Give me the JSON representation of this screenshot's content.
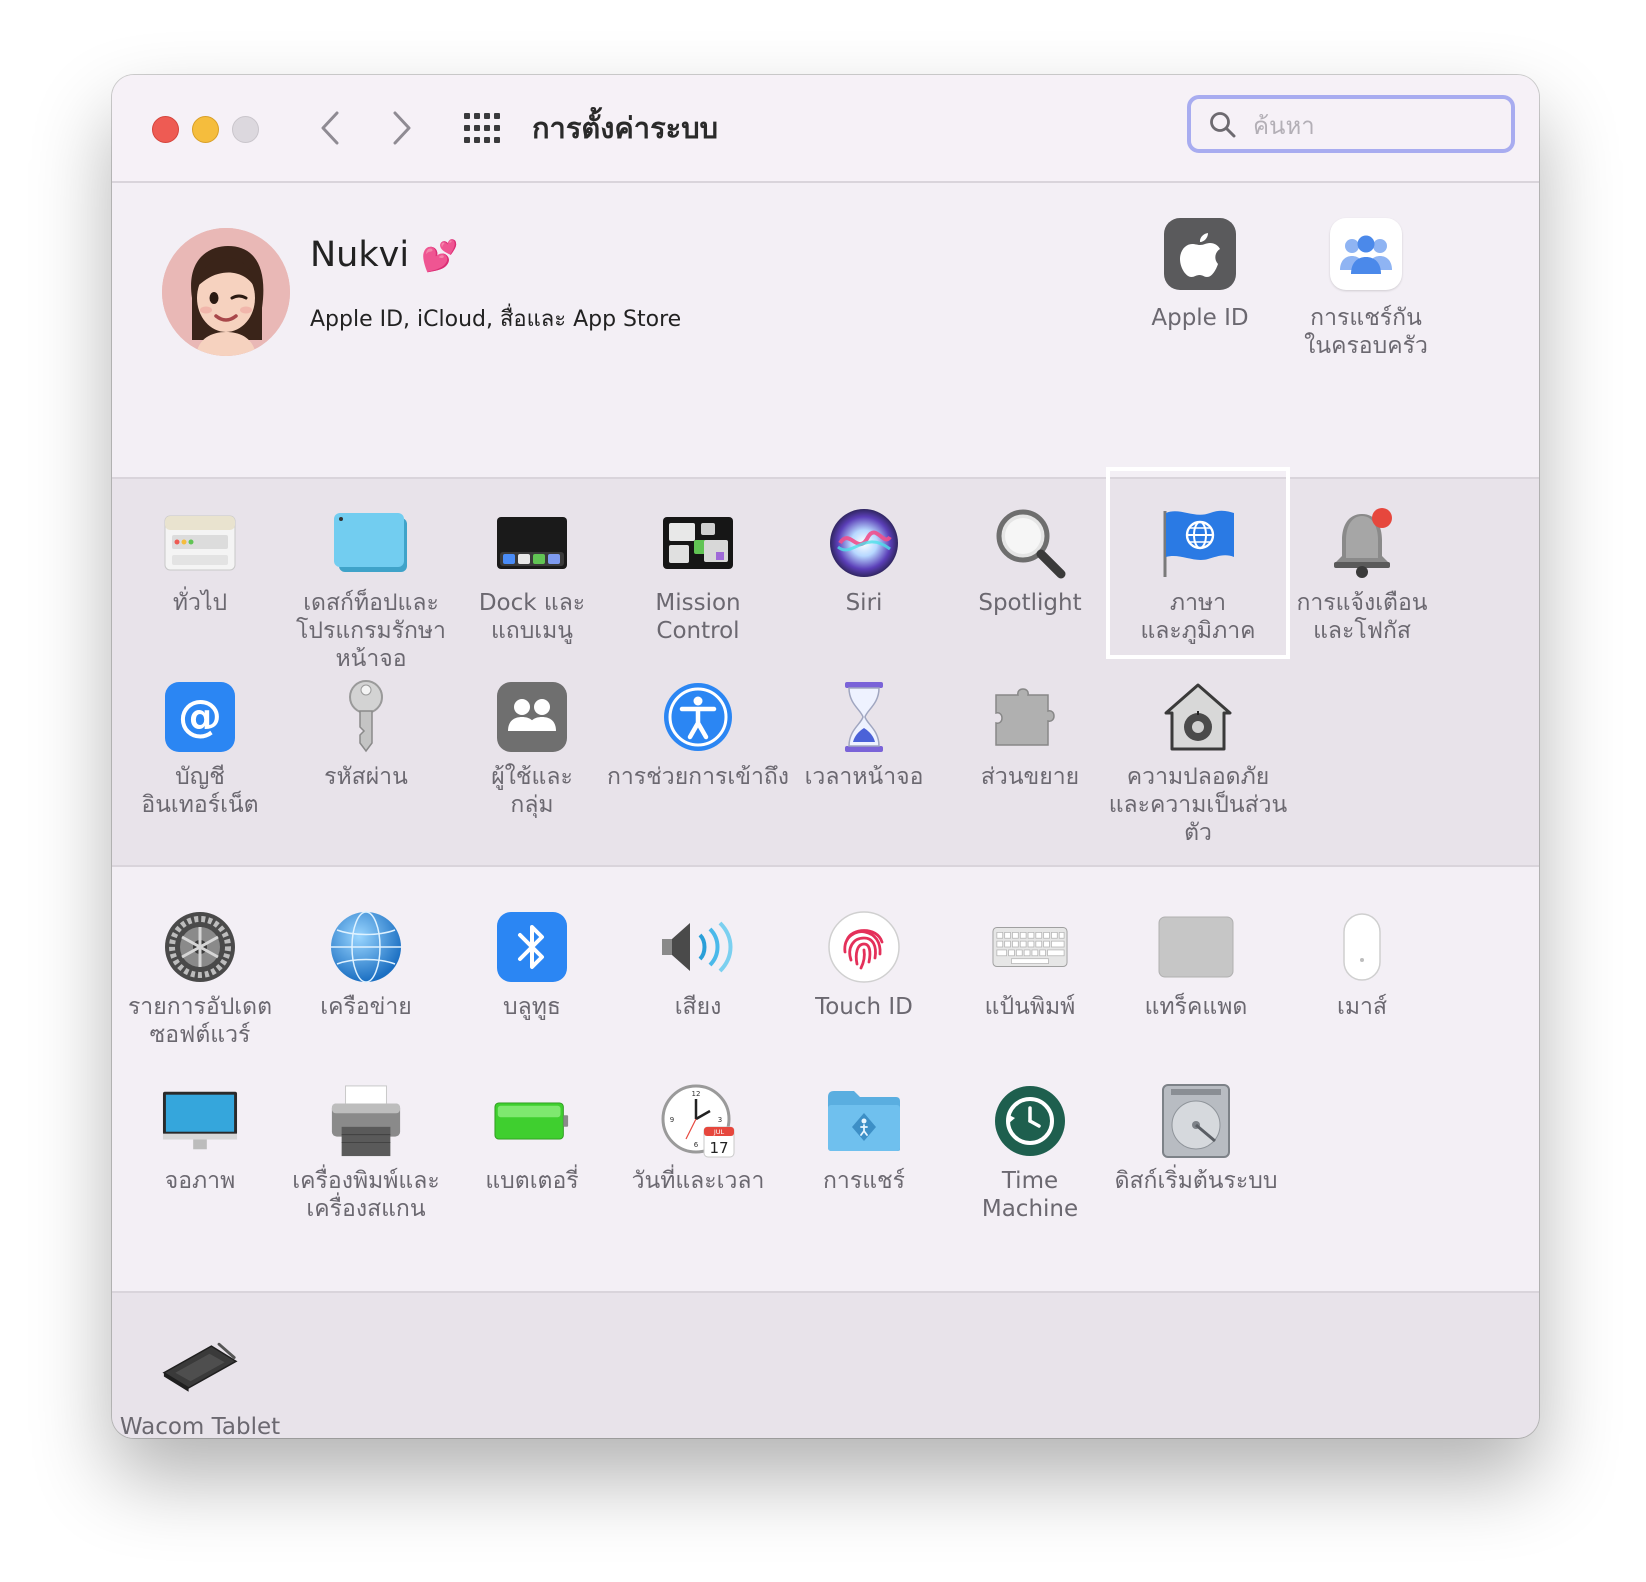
{
  "window": {
    "title": "การตั้งค่าระบบ",
    "search_placeholder": "ค้นหา"
  },
  "account": {
    "name": "Nukvi",
    "emoji": "💕",
    "subtitle": "Apple ID, iCloud, สื่อและ App Store",
    "apple_id_label": "Apple ID",
    "family_label_1": "การแชร์กัน",
    "family_label_2": "ในครอบครัว"
  },
  "section1": {
    "general": [
      "ทั่วไป"
    ],
    "desktop": [
      "เดสก์ท็อปและ",
      "โปรแกรมรักษาหน้าจอ"
    ],
    "dock": [
      "Dock และ",
      "แถบเมนู"
    ],
    "mission": [
      "Mission",
      "Control"
    ],
    "siri": [
      "Siri"
    ],
    "spotlight": [
      "Spotlight"
    ],
    "language": [
      "ภาษา",
      "และภูมิภาค"
    ],
    "notifications": [
      "การแจ้งเตือน",
      "และโฟกัส"
    ],
    "internet_accounts": [
      "บัญชี",
      "อินเทอร์เน็ต"
    ],
    "passwords": [
      "รหัสผ่าน"
    ],
    "users": [
      "ผู้ใช้และ",
      "กลุ่ม"
    ],
    "accessibility": [
      "การช่วยการเข้าถึง"
    ],
    "screen_time": [
      "เวลาหน้าจอ"
    ],
    "extensions": [
      "ส่วนขยาย"
    ],
    "security": [
      "ความปลอดภัย",
      "และความเป็นส่วนตัว"
    ]
  },
  "section2": {
    "software_update": [
      "รายการอัปเดต",
      "ซอฟต์แวร์"
    ],
    "network": [
      "เครือข่าย"
    ],
    "bluetooth": [
      "บลูทูธ"
    ],
    "sound": [
      "เสียง"
    ],
    "touch_id": [
      "Touch ID"
    ],
    "keyboard": [
      "แป้นพิมพ์"
    ],
    "trackpad": [
      "แทร็คแพด"
    ],
    "mouse": [
      "เมาส์"
    ],
    "displays": [
      "จอภาพ"
    ],
    "printers": [
      "เครื่องพิมพ์และ",
      "เครื่องสแกน"
    ],
    "battery": [
      "แบตเตอรี่"
    ],
    "date_time": [
      "วันที่และเวลา"
    ],
    "sharing": [
      "การแชร์"
    ],
    "time_machine": [
      "Time",
      "Machine"
    ],
    "startup_disk": [
      "ดิสก์เริ่มต้นระบบ"
    ],
    "calendar_month": "JUL",
    "calendar_day": "17"
  },
  "section3": {
    "wacom": [
      "Wacom Tablet"
    ]
  },
  "colors": {
    "accent": "#a8acf0",
    "close": "#ee5b53",
    "minimize": "#f5bd3d"
  }
}
